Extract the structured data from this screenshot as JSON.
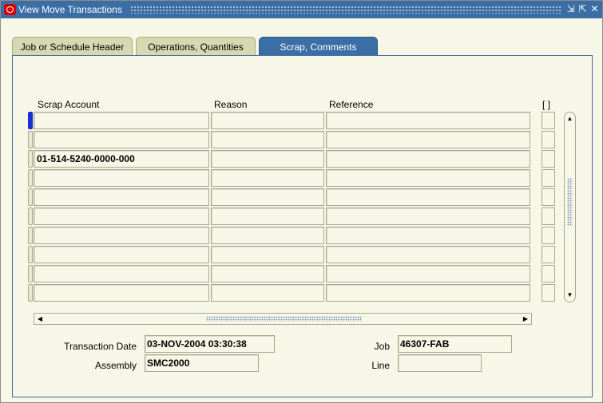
{
  "window": {
    "title": "View Move Transactions",
    "controls": {
      "minimize": "⇲",
      "maximize": "⇱",
      "close": "✕"
    }
  },
  "tabs": [
    {
      "label": "Job or Schedule Header",
      "active": false
    },
    {
      "label": "Operations, Quantities",
      "active": false
    },
    {
      "label": "Scrap, Comments",
      "active": true
    }
  ],
  "table": {
    "columns": {
      "scrap_account": "Scrap Account",
      "reason": "Reason",
      "reference": "Reference",
      "flex": "[ ]"
    },
    "rows": [
      {
        "scrap_account": "",
        "reason": "",
        "reference": ""
      },
      {
        "scrap_account": "",
        "reason": "",
        "reference": ""
      },
      {
        "scrap_account": "01-514-5240-0000-000",
        "reason": "",
        "reference": ""
      },
      {
        "scrap_account": "",
        "reason": "",
        "reference": ""
      },
      {
        "scrap_account": "",
        "reason": "",
        "reference": ""
      },
      {
        "scrap_account": "",
        "reason": "",
        "reference": ""
      },
      {
        "scrap_account": "",
        "reason": "",
        "reference": ""
      },
      {
        "scrap_account": "",
        "reason": "",
        "reference": ""
      },
      {
        "scrap_account": "",
        "reason": "",
        "reference": ""
      },
      {
        "scrap_account": "",
        "reason": "",
        "reference": ""
      }
    ],
    "current_row": 0
  },
  "footer": {
    "transaction_date_label": "Transaction Date",
    "transaction_date_value": "03-NOV-2004 03:30:38",
    "assembly_label": "Assembly",
    "assembly_value": "SMC2000",
    "job_label": "Job",
    "job_value": "46307-FAB",
    "line_label": "Line",
    "line_value": ""
  },
  "colors": {
    "accent": "#3b6ea5",
    "background": "#f7f7e7",
    "tab_inactive": "#d8d8b0",
    "current_row": "#1a2fd6"
  }
}
